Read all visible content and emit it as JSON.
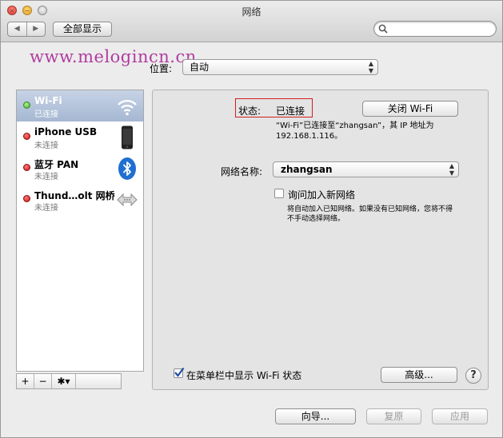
{
  "window": {
    "title": "网络"
  },
  "toolbar": {
    "back_glyph": "◀",
    "forward_glyph": "▶",
    "show_all": "全部显示",
    "search": {
      "value": "",
      "placeholder": ""
    }
  },
  "watermark": "www.melogincn.cn",
  "location": {
    "label": "位置:",
    "value": "自动"
  },
  "services": [
    {
      "name": "Wi-Fi",
      "status": "已连接",
      "state": "green",
      "icon": "wifi-icon",
      "selected": true
    },
    {
      "name": "iPhone USB",
      "status": "未连接",
      "state": "red",
      "icon": "iphone-icon",
      "selected": false
    },
    {
      "name": "蓝牙 PAN",
      "status": "未连接",
      "state": "red",
      "icon": "bluetooth-icon",
      "selected": false
    },
    {
      "name": "Thund…olt 网桥",
      "status": "未连接",
      "state": "red",
      "icon": "thunderbolt-bridge-icon",
      "selected": false
    }
  ],
  "sidebar_controls": {
    "add": "+",
    "remove": "−",
    "gear": "✱▾"
  },
  "detail": {
    "status_label": "状态:",
    "status_value": "已连接",
    "toggle_button": "关闭 Wi-Fi",
    "status_desc": "“Wi-Fi”已连接至“zhangsan”，其 IP 地址为 192.168.1.116。",
    "network_name_label": "网络名称:",
    "network_name_value": "zhangsan",
    "ask_join_label": "询问加入新网络",
    "ask_join_checked": false,
    "ask_join_desc": "将自动加入已知网络。如果没有已知网络，您将不得不手动选择网络。",
    "show_menu_label": "在菜单栏中显示 Wi-Fi 状态",
    "show_menu_checked": true,
    "advanced_button": "高级...",
    "help_button": "?"
  },
  "footer": {
    "assist_button": "向导...",
    "revert_button": "复原",
    "apply_button": "应用"
  },
  "colors": {
    "selection": "#a5b7d2",
    "connected": "#3ca61c",
    "disconnected": "#c41010",
    "watermark": "#b03da0",
    "highlight_box": "#d21e1e"
  }
}
